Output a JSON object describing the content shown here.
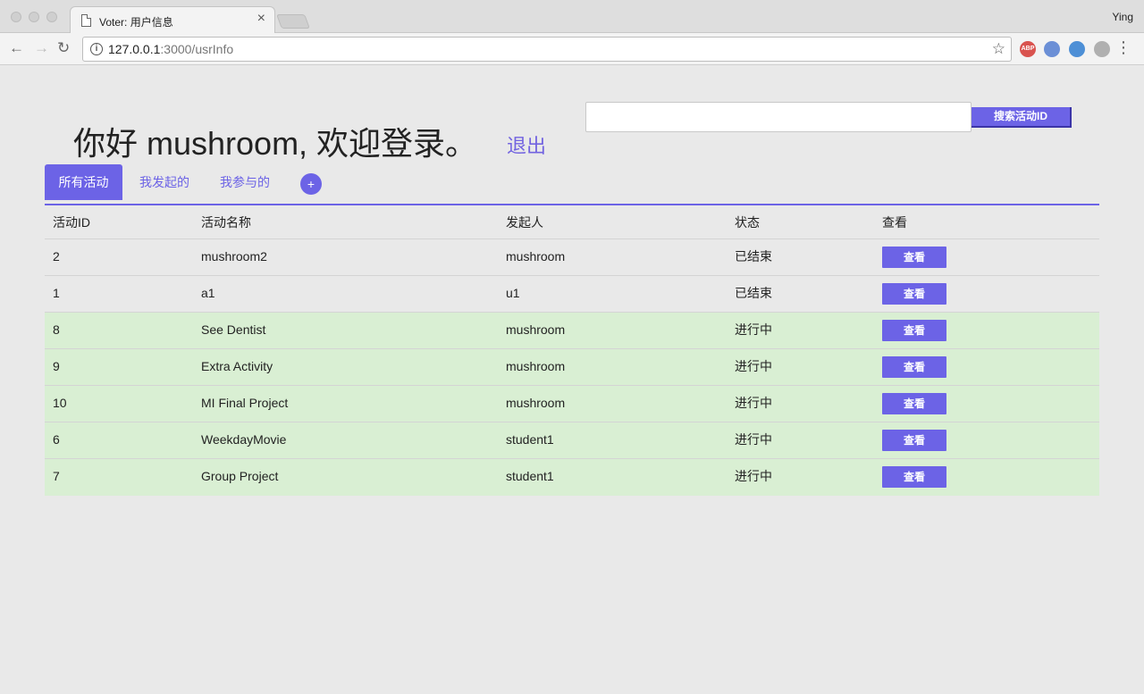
{
  "browser": {
    "tab_title": "Voter: 用户信息",
    "profile_name": "Ying",
    "url_host": "127.0.0.1",
    "url_path": ":3000/usrInfo",
    "extensions": [
      {
        "name": "abp-icon",
        "label": "ABP",
        "color": "#d9534f"
      },
      {
        "name": "translate-icon",
        "label": "",
        "color": "#6b8fd6"
      },
      {
        "name": "cube-icon",
        "label": "",
        "color": "#4d8fd6"
      },
      {
        "name": "atom-icon",
        "label": "",
        "color": "#b0b0b0"
      }
    ]
  },
  "header": {
    "greeting": "你好 mushroom, 欢迎登录。",
    "logout_label": "退出"
  },
  "search": {
    "placeholder": "",
    "value": "",
    "button_label": "搜索活动ID"
  },
  "tabs": [
    {
      "label": "所有活动",
      "active": true
    },
    {
      "label": "我发起的",
      "active": false
    },
    {
      "label": "我参与的",
      "active": false
    }
  ],
  "add_label": "+",
  "table": {
    "columns": [
      "活动ID",
      "活动名称",
      "发起人",
      "状态",
      "查看"
    ],
    "rows": [
      {
        "id": "2",
        "name": "mushroom2",
        "owner": "mushroom",
        "status": "已结束",
        "action": "查看",
        "ongoing": false
      },
      {
        "id": "1",
        "name": "a1",
        "owner": "u1",
        "status": "已结束",
        "action": "查看",
        "ongoing": false
      },
      {
        "id": "8",
        "name": "See Dentist",
        "owner": "mushroom",
        "status": "进行中",
        "action": "查看",
        "ongoing": true
      },
      {
        "id": "9",
        "name": "Extra Activity",
        "owner": "mushroom",
        "status": "进行中",
        "action": "查看",
        "ongoing": true
      },
      {
        "id": "10",
        "name": "MI Final Project",
        "owner": "mushroom",
        "status": "进行中",
        "action": "查看",
        "ongoing": true
      },
      {
        "id": "6",
        "name": "WeekdayMovie",
        "owner": "student1",
        "status": "进行中",
        "action": "查看",
        "ongoing": true
      },
      {
        "id": "7",
        "name": "Group Project",
        "owner": "student1",
        "status": "进行中",
        "action": "查看",
        "ongoing": true
      }
    ]
  },
  "colors": {
    "accent": "#6c63e6",
    "ongoing_row": "#d9efd3"
  }
}
